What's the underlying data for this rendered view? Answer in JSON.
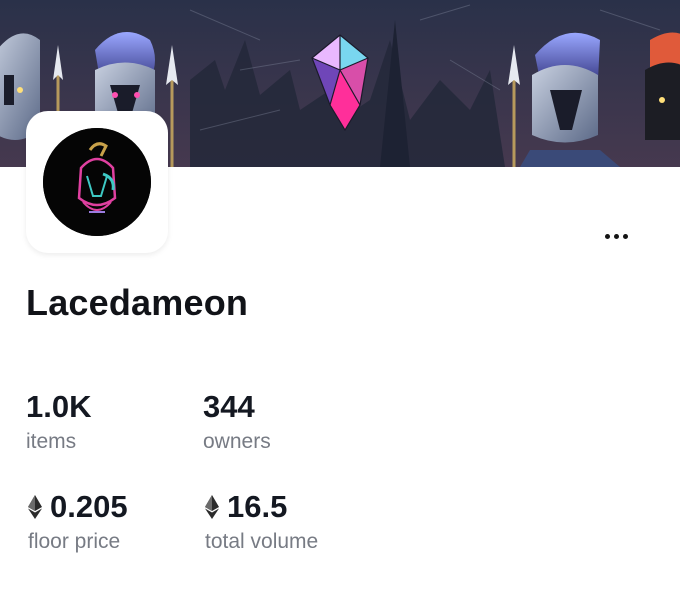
{
  "collection": {
    "name": "Lacedameon",
    "more_icon": "more-horizontal-icon"
  },
  "stats": {
    "items": {
      "value": "1.0K",
      "label": "items"
    },
    "owners": {
      "value": "344",
      "label": "owners"
    },
    "floor_price": {
      "value": "0.205",
      "label": "floor price",
      "currency_icon": "ethereum-icon"
    },
    "total_volume": {
      "value": "16.5",
      "label": "total volume",
      "currency_icon": "ethereum-icon"
    }
  },
  "colors": {
    "text_primary": "#111318",
    "text_secondary": "#777b84",
    "banner_dark": "#2e3650",
    "accent_pink": "#e040a0",
    "accent_teal": "#3ec9c4"
  }
}
